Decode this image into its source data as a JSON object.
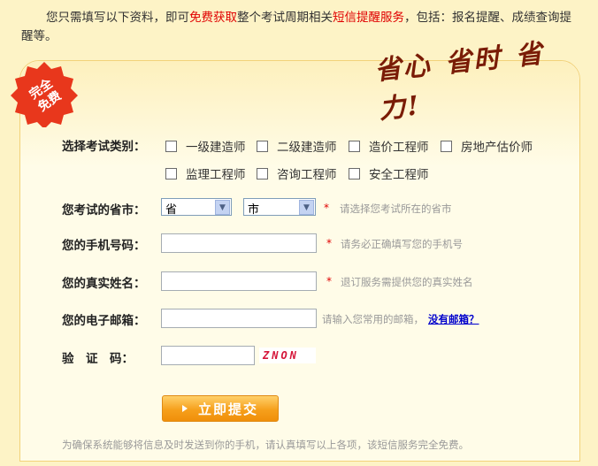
{
  "intro": {
    "p1": "您只需填写以下资料，即可",
    "free": "免费获取",
    "p2": "整个考试周期相关",
    "sms": "短信提醒服务",
    "p3": "，包括：报名提醒、成绩查询提醒等。"
  },
  "badge": {
    "line1": "完全",
    "line2": "免费",
    "color": "#e8371c"
  },
  "brush": {
    "w1": "省心",
    "w2": "省时",
    "w3": "省力!"
  },
  "form": {
    "category_label": "选择考试类别：",
    "categories": [
      "一级建造师",
      "二级建造师",
      "造价工程师",
      "房地产估价师",
      "监理工程师",
      "咨询工程师",
      "安全工程师"
    ],
    "province_label": "您考试的省市：",
    "province_value": "省",
    "city_value": "市",
    "province_hint": "请选择您考试所在的省市",
    "phone_label": "您的手机号码：",
    "phone_hint": "请务必正确填写您的手机号",
    "name_label": "您的真实姓名：",
    "name_hint": "退订服务需提供您的真实姓名",
    "email_label": "您的电子邮箱：",
    "email_hint": "请输入您常用的邮箱，",
    "email_link": "没有邮箱？",
    "captcha_label": "验　证　码：",
    "captcha_value": "ZNON",
    "required_mark": "*",
    "submit": "立即提交"
  },
  "footer": "为确保系统能够将信息及时发送到你的手机，请认真填写以上各项，该短信服务完全免费。"
}
